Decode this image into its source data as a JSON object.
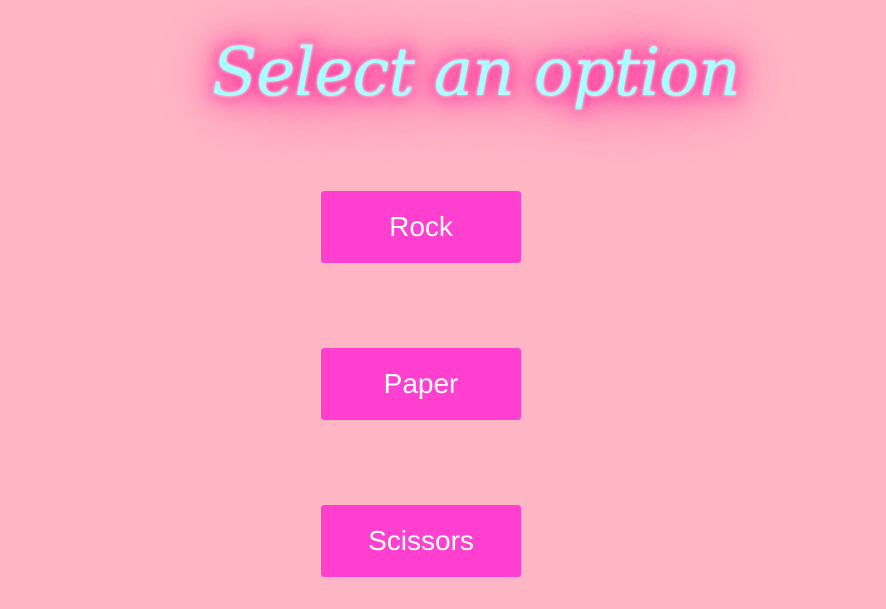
{
  "title": "Select an option",
  "options": [
    {
      "label": "Rock"
    },
    {
      "label": "Paper"
    },
    {
      "label": "Scissors"
    }
  ],
  "colors": {
    "background": "#ffb6c4",
    "button": "#ff3fd0",
    "button_text": "#ffffff",
    "title_text": "#a8ffff",
    "title_glow": "#ff1f94"
  }
}
